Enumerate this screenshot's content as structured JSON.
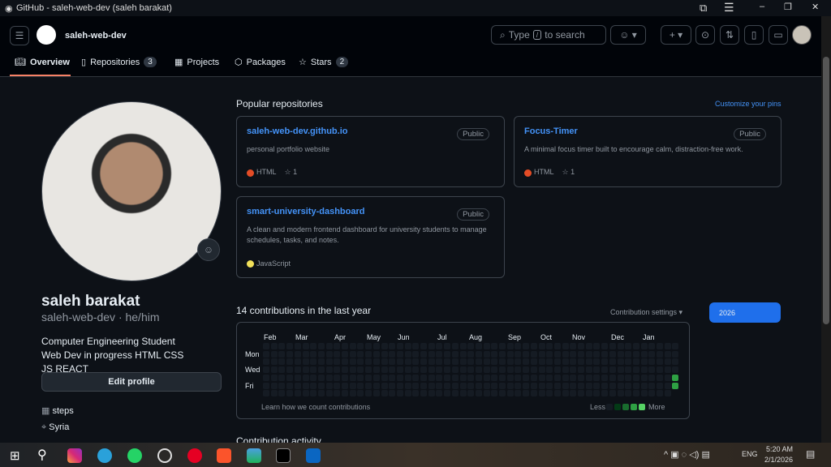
{
  "window": {
    "title": "GitHub - saleh-web-dev (saleh barakat)"
  },
  "header": {
    "username": "saleh-web-dev",
    "search_prefix": "Type",
    "search_key": "/",
    "search_suffix": "to search"
  },
  "tabs": [
    {
      "label": "Overview"
    },
    {
      "label": "Repositories",
      "count": "3"
    },
    {
      "label": "Projects"
    },
    {
      "label": "Packages"
    },
    {
      "label": "Stars",
      "count": "2"
    }
  ],
  "profile": {
    "name": "saleh barakat",
    "handle": "saleh-web-dev · he/him",
    "bio": "Computer Engineering Student Web Dev in progress HTML CSS JS REACT",
    "edit": "Edit profile",
    "details": [
      "steps",
      "Syria"
    ]
  },
  "popular": {
    "title": "Popular repositories",
    "customize": "Customize your pins",
    "repos": [
      {
        "name": "saleh-web-dev.github.io",
        "visibility": "Public",
        "desc": "personal portfolio website",
        "lang": "HTML",
        "lang_color": "#e34c26",
        "stars": "1"
      },
      {
        "name": "Focus-Timer",
        "visibility": "Public",
        "desc": "A minimal focus timer built to encourage calm, distraction-free work.",
        "lang": "HTML",
        "lang_color": "#e34c26",
        "stars": "1"
      },
      {
        "name": "smart-university-dashboard",
        "visibility": "Public",
        "desc": "A clean and modern frontend dashboard for university students to manage schedules, tasks, and notes.",
        "lang": "JavaScript",
        "lang_color": "#f1e05a",
        "stars": ""
      }
    ]
  },
  "contributions": {
    "title": "14 contributions in the last year",
    "settings": "Contribution settings",
    "year": "2026",
    "months": [
      "Feb",
      "Mar",
      "Apr",
      "May",
      "Jun",
      "Jul",
      "Aug",
      "Sep",
      "Oct",
      "Nov",
      "Dec",
      "Jan"
    ],
    "days": [
      "Mon",
      "Wed",
      "Fri"
    ],
    "learn": "Learn how we count contributions",
    "less": "Less",
    "more": "More",
    "active_cells": [
      [
        52,
        4,
        3
      ],
      [
        52,
        5,
        3
      ]
    ]
  },
  "activity": {
    "title": "Contribution activity"
  },
  "taskbar": {
    "lang": "ENG",
    "time": "5:20 AM",
    "date": "2/1/2026"
  }
}
